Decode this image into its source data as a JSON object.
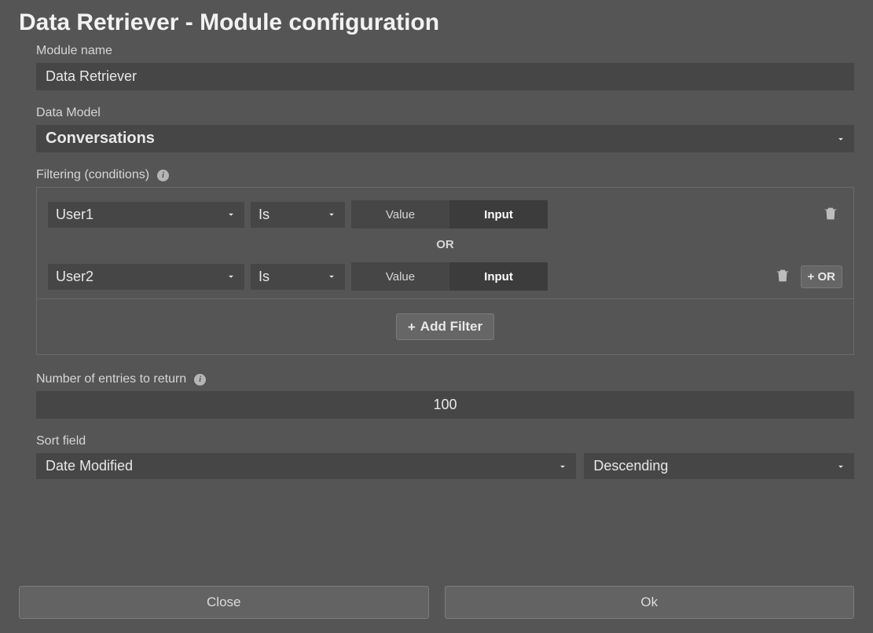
{
  "title": "Data Retriever - Module configuration",
  "labels": {
    "module_name": "Module name",
    "data_model": "Data Model",
    "filtering": "Filtering (conditions)",
    "num_entries": "Number of entries to return",
    "sort_field": "Sort field"
  },
  "values": {
    "module_name": "Data Retriever",
    "data_model": "Conversations",
    "num_entries": "100",
    "sort_field": "Date Modified",
    "sort_dir": "Descending"
  },
  "filters": {
    "or_label": "OR",
    "toggle": {
      "value": "Value",
      "input": "Input"
    },
    "rows": [
      {
        "field": "User1",
        "operator": "Is",
        "mode": "Input"
      },
      {
        "field": "User2",
        "operator": "Is",
        "mode": "Input"
      }
    ],
    "add_or_label": "+ OR",
    "add_filter_label": "Add Filter"
  },
  "footer": {
    "close": "Close",
    "ok": "Ok"
  }
}
